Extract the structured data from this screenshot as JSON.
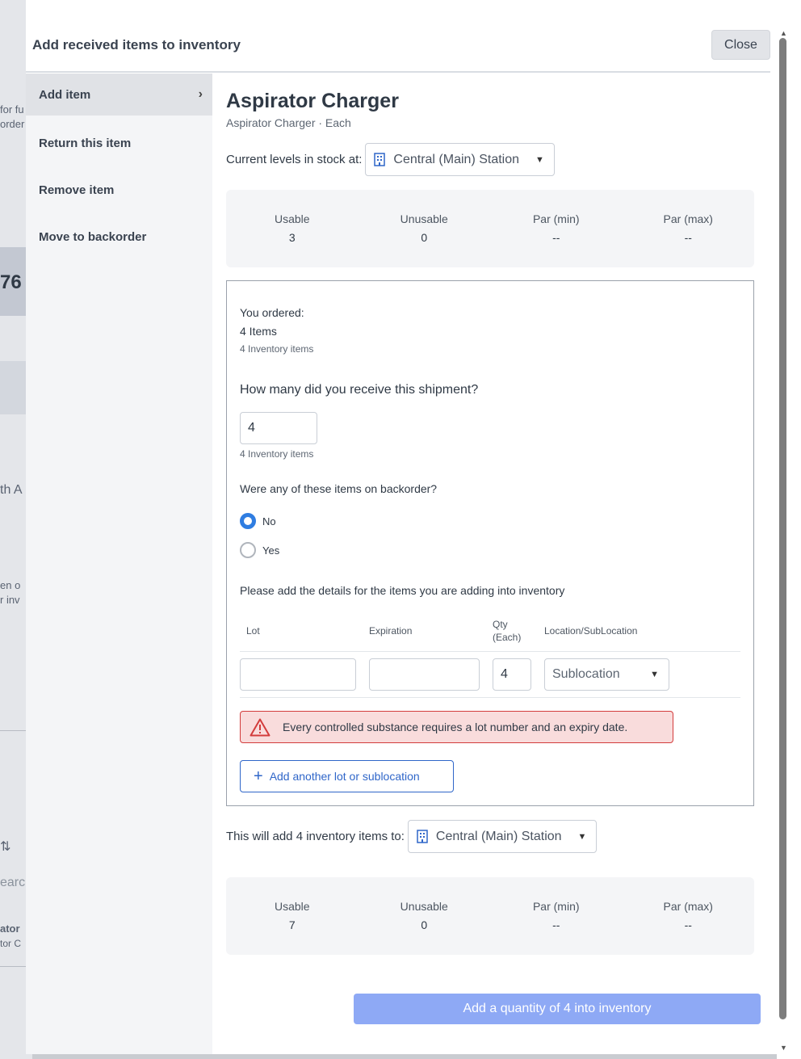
{
  "background": {
    "fragments": [
      "for fu",
      "order",
      "76",
      "th A",
      "en o",
      "r inv",
      "⇅",
      "earc",
      "ator",
      "tor C"
    ]
  },
  "modal": {
    "title": "Add received items to inventory",
    "close_label": "Close"
  },
  "sidebar": {
    "items": [
      {
        "label": "Add item",
        "active": true
      },
      {
        "label": "Return this item"
      },
      {
        "label": "Remove item"
      },
      {
        "label": "Move to backorder"
      }
    ]
  },
  "item": {
    "name": "Aspirator Charger",
    "subtitle": "Aspirator Charger · Each"
  },
  "current_levels": {
    "label": "Current levels in stock at:",
    "location": "Central (Main) Station",
    "stats": [
      {
        "label": "Usable",
        "value": "3"
      },
      {
        "label": "Unusable",
        "value": "0"
      },
      {
        "label": "Par (min)",
        "value": "--"
      },
      {
        "label": "Par (max)",
        "value": "--"
      }
    ]
  },
  "order": {
    "ordered_label": "You ordered:",
    "ordered_qty": "4 Items",
    "ordered_inv": "4 Inventory items",
    "received_question": "How many did you receive this shipment?",
    "received_value": "4",
    "received_inv": "4 Inventory items",
    "backorder_question": "Were any of these items on backorder?",
    "backorder_options": [
      "No",
      "Yes"
    ],
    "details_prompt": "Please add the details for the items you are adding into inventory",
    "columns": {
      "lot": "Lot",
      "expiration": "Expiration",
      "qty": "Qty\n(Each)",
      "location": "Location/SubLocation"
    },
    "row": {
      "lot": "",
      "expiration": "",
      "qty": "4",
      "sublocation": "Sublocation"
    },
    "alert": "Every controlled substance requires a lot number and an expiry date.",
    "add_lot_label": "Add another lot or sublocation"
  },
  "destination": {
    "label": "This will add 4 inventory items to:",
    "location": "Central (Main) Station",
    "stats": [
      {
        "label": "Usable",
        "value": "7"
      },
      {
        "label": "Unusable",
        "value": "0"
      },
      {
        "label": "Par (min)",
        "value": "--"
      },
      {
        "label": "Par (max)",
        "value": "--"
      }
    ]
  },
  "submit_label": "Add a quantity of 4 into inventory",
  "colors": {
    "primary": "#2f66c9",
    "radio": "#2f7de1",
    "alert_bg": "#f9dcdc",
    "alert_border": "#d33c3c",
    "submit_disabled": "#8ea9f5"
  }
}
